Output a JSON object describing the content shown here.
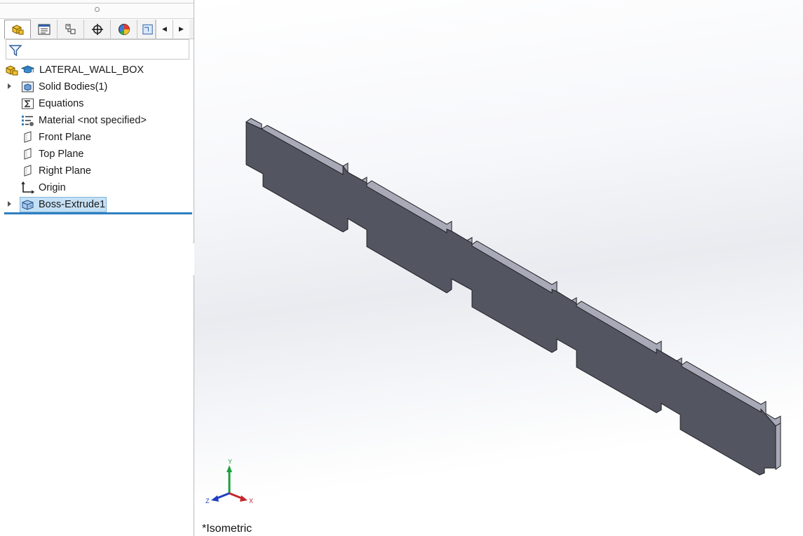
{
  "feature_tree": {
    "part_name": "LATERAL_WALL_BOX",
    "items": [
      {
        "label": "Solid Bodies(1)",
        "icon": "solid-bodies-icon",
        "expandable": true
      },
      {
        "label": "Equations",
        "icon": "equations-icon",
        "expandable": false
      },
      {
        "label": "Material <not specified>",
        "icon": "material-icon",
        "expandable": false
      },
      {
        "label": "Front Plane",
        "icon": "plane-icon",
        "expandable": false
      },
      {
        "label": "Top Plane",
        "icon": "plane-icon",
        "expandable": false
      },
      {
        "label": "Right Plane",
        "icon": "plane-icon",
        "expandable": false
      },
      {
        "label": "Origin",
        "icon": "origin-icon",
        "expandable": false
      },
      {
        "label": "Boss-Extrude1",
        "icon": "extrude-icon",
        "expandable": true,
        "selected": true
      }
    ]
  },
  "tabs": [
    {
      "name": "feature-manager-tab",
      "active": true
    },
    {
      "name": "property-manager-tab",
      "active": false
    },
    {
      "name": "configuration-manager-tab",
      "active": false
    },
    {
      "name": "dimxpert-manager-tab",
      "active": false
    },
    {
      "name": "display-manager-tab",
      "active": false
    },
    {
      "name": "cam-tab",
      "active": false
    }
  ],
  "viewport": {
    "view_name": "*Isometric",
    "triad": {
      "x": "X",
      "y": "Y",
      "z": "Z"
    }
  },
  "colors": {
    "part_face": "#535661",
    "part_top": "#a8aab8",
    "selection": "#c5e0f5",
    "rollback_bar": "#2f7fbf"
  }
}
